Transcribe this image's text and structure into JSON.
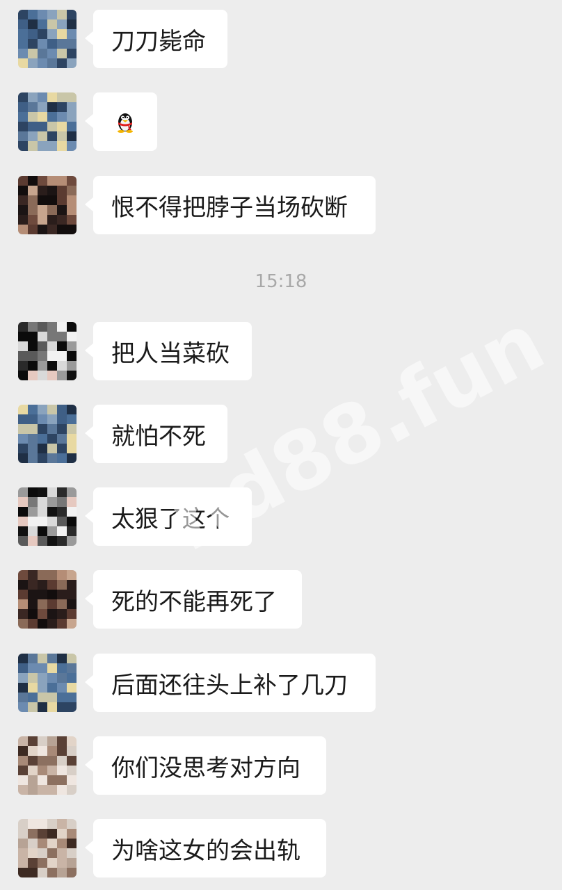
{
  "time_divider": "15:18",
  "watermark": "hd88.fun",
  "messages": [
    {
      "text": "刀刀毙命",
      "avatar": "avatar-blue-sky",
      "emoji": false
    },
    {
      "text": "",
      "avatar": "avatar-blue-sky",
      "emoji": true,
      "emoji_name": "qq-penguin-emoji"
    },
    {
      "text": "恨不得把脖子当场砍断",
      "avatar": "avatar-dark-portrait",
      "emoji": false
    },
    {
      "text": "把人当菜砍",
      "avatar": "avatar-black-white",
      "emoji": false
    },
    {
      "text": "就怕不死",
      "avatar": "avatar-blue-sky",
      "emoji": false
    },
    {
      "text": "太狠了这个",
      "avatar": "avatar-black-white",
      "emoji": false
    },
    {
      "text": "死的不能再死了",
      "avatar": "avatar-dark-portrait",
      "emoji": false
    },
    {
      "text": "后面还往头上补了几刀",
      "avatar": "avatar-blue-sky",
      "emoji": false
    },
    {
      "text": "你们没思考对方向",
      "avatar": "avatar-light-portrait",
      "emoji": false
    },
    {
      "text": "为啥这女的会出轨",
      "avatar": "avatar-light-portrait",
      "emoji": false
    }
  ]
}
